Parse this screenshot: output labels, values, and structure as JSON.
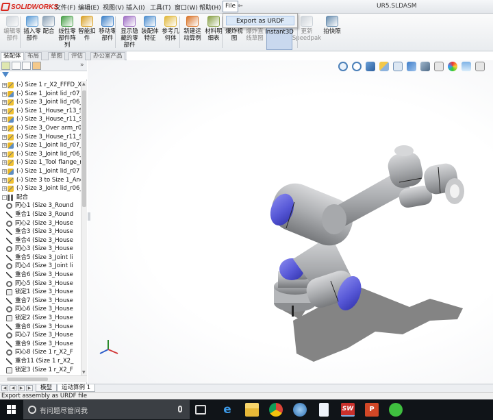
{
  "app": {
    "brand": "SOLIDWORKS",
    "document_title": "UR5.SLDASM"
  },
  "menus": [
    "文件(F)",
    "编辑(E)",
    "视图(V)",
    "插入(I)",
    "工具(T)",
    "窗口(W)",
    "帮助(H)",
    "File"
  ],
  "active_menu": "File",
  "dropdown": {
    "item": "Export as URDF"
  },
  "toolbar": [
    {
      "label": "编辑零\n部件",
      "icon": "edit-component-icon",
      "dim": true
    },
    {
      "label": "插入零\n部件",
      "icon": "insert-component-icon"
    },
    {
      "label": "配合",
      "icon": "mate-icon"
    },
    {
      "label": "线性零\n部件阵\n列",
      "icon": "linear-pattern-icon"
    },
    {
      "label": "智能扣\n件",
      "icon": "smart-fastener-icon"
    },
    {
      "label": "移动零\n部件",
      "icon": "move-component-icon"
    },
    {
      "label": "显示隐\n藏的零\n部件",
      "icon": "show-hidden-icon"
    },
    {
      "label": "装配体\n特征",
      "icon": "assembly-feature-icon"
    },
    {
      "label": "参考几\n何体",
      "icon": "reference-geometry-icon"
    },
    {
      "label": "新建运\n动算例",
      "icon": "new-motion-study-icon"
    },
    {
      "label": "材料明\n细表",
      "icon": "bom-icon"
    },
    {
      "label": "爆炸视\n图",
      "icon": "exploded-view-icon"
    },
    {
      "label": "爆炸直\n线草图",
      "icon": "explode-line-sketch-icon",
      "dim": true
    },
    {
      "label": "Instant3D",
      "icon": "instant3d-icon",
      "pressed": true
    },
    {
      "label": "更新\nSpeedpak",
      "icon": "speedpak-icon",
      "dim": true
    },
    {
      "label": "拍快照",
      "icon": "snapshot-icon"
    }
  ],
  "command_tabs": [
    "装配体",
    "布局",
    "草图",
    "评估",
    "办公室产品"
  ],
  "active_command_tab": "装配体",
  "feature_tree": [
    {
      "text": "(-) Size 1 r_X2_FFFD_XC",
      "kind": "part",
      "expander": "+"
    },
    {
      "text": "(-) Size 1_Joint lid_r07_",
      "kind": "part",
      "expander": "+"
    },
    {
      "text": "(-) Size 3_Joint lid_r06_",
      "kind": "part",
      "expander": "+"
    },
    {
      "text": "(-) Size 1_House_r13_S",
      "kind": "part",
      "expander": "+"
    },
    {
      "text": "(-) Size 3_House_r11_S",
      "kind": "part",
      "expander": "+"
    },
    {
      "text": "(-) Size 3_Over arm_r0",
      "kind": "part",
      "expander": "+"
    },
    {
      "text": "(-) Size 3_House_r11_S",
      "kind": "part",
      "expander": "+"
    },
    {
      "text": "(-) Size 1_Joint lid_r07_",
      "kind": "part",
      "expander": "+"
    },
    {
      "text": "(-) Size 3_Joint lid_r06_",
      "kind": "part",
      "expander": "+"
    },
    {
      "text": "(-) Size 1_Tool flange_r",
      "kind": "part",
      "expander": "+"
    },
    {
      "text": "(-) Size 1_Joint lid_r07",
      "kind": "part",
      "expander": "+"
    },
    {
      "text": "(-) Size 3 to Size 1_Anc",
      "kind": "part",
      "expander": "+"
    },
    {
      "text": "(-) Size 3_Joint lid_r06_",
      "kind": "part",
      "expander": "+"
    },
    {
      "text": "配合",
      "kind": "mates",
      "expander": "-"
    },
    {
      "text": "同心1 (Size 3_Round",
      "kind": "conc"
    },
    {
      "text": "重合1 (Size 3_Round",
      "kind": "coin"
    },
    {
      "text": "同心2 (Size 3_House",
      "kind": "conc"
    },
    {
      "text": "重合3 (Size 3_House",
      "kind": "coin"
    },
    {
      "text": "重合4 (Size 3_House",
      "kind": "coin"
    },
    {
      "text": "同心3 (Size 3_House",
      "kind": "conc"
    },
    {
      "text": "重合5 (Size 3_Joint li",
      "kind": "coin"
    },
    {
      "text": "同心4 (Size 3_Joint li",
      "kind": "conc"
    },
    {
      "text": "重合6 (Size 3_House",
      "kind": "coin"
    },
    {
      "text": "同心5 (Size 3_House",
      "kind": "conc"
    },
    {
      "text": "锁定1 (Size 3_House",
      "kind": "lock"
    },
    {
      "text": "重合7 (Size 3_House",
      "kind": "coin"
    },
    {
      "text": "同心6 (Size 3_House",
      "kind": "conc"
    },
    {
      "text": "锁定2 (Size 3_House",
      "kind": "lock"
    },
    {
      "text": "重合8 (Size 3_House",
      "kind": "coin"
    },
    {
      "text": "同心7 (Size 3_House",
      "kind": "conc"
    },
    {
      "text": "重合9 (Size 3_House",
      "kind": "coin"
    },
    {
      "text": "同心8 (Size 1 r_X2_F",
      "kind": "conc"
    },
    {
      "text": "重合11 (Size 1 r_X2_",
      "kind": "coin"
    },
    {
      "text": "锁定3 (Size 1 r_X2_F",
      "kind": "lock"
    }
  ],
  "bottom_tabs": [
    "模型",
    "运动算例 1"
  ],
  "active_bottom_tab": "运动算例 1",
  "status_bar": "Export assembly as URDF file",
  "taskbar": {
    "search_placeholder": "有问题尽管问我"
  },
  "colors": {
    "robot_body": "#a9abae",
    "robot_cap": "#5657d6",
    "accent": "#d9261c",
    "selection": "#dbe8f7"
  }
}
